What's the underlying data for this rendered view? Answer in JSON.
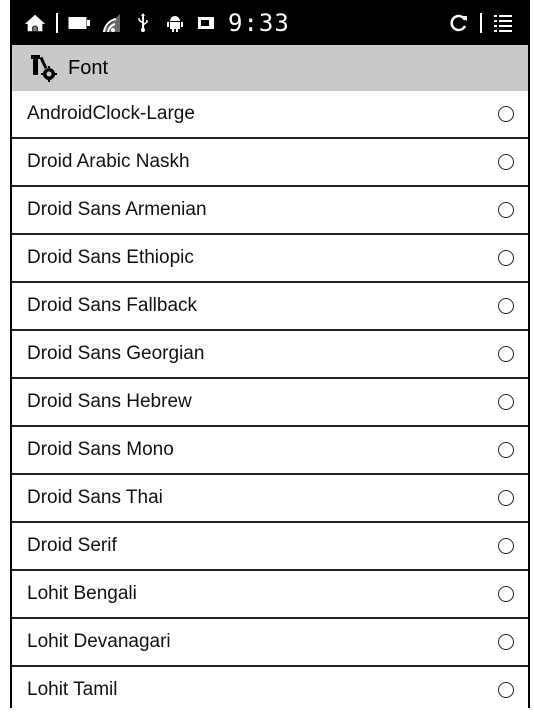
{
  "statusbar": {
    "clock": "9:33",
    "icons": [
      "home-icon",
      "battery-icon",
      "wifi-icon",
      "usb-icon",
      "android-debug-icon",
      "screen-icon",
      "refresh-icon",
      "menu-icon"
    ]
  },
  "header": {
    "title": "Font",
    "icon": "settings-tools-icon"
  },
  "fonts": [
    {
      "label": "AndroidClock-Large"
    },
    {
      "label": "Droid Arabic Naskh"
    },
    {
      "label": "Droid Sans Armenian"
    },
    {
      "label": "Droid Sans Ethiopic"
    },
    {
      "label": "Droid Sans Fallback"
    },
    {
      "label": "Droid Sans Georgian"
    },
    {
      "label": "Droid Sans Hebrew"
    },
    {
      "label": "Droid Sans Mono"
    },
    {
      "label": "Droid Sans Thai"
    },
    {
      "label": "Droid Serif"
    },
    {
      "label": "Lohit Bengali"
    },
    {
      "label": "Lohit Devanagari"
    },
    {
      "label": "Lohit Tamil"
    }
  ]
}
